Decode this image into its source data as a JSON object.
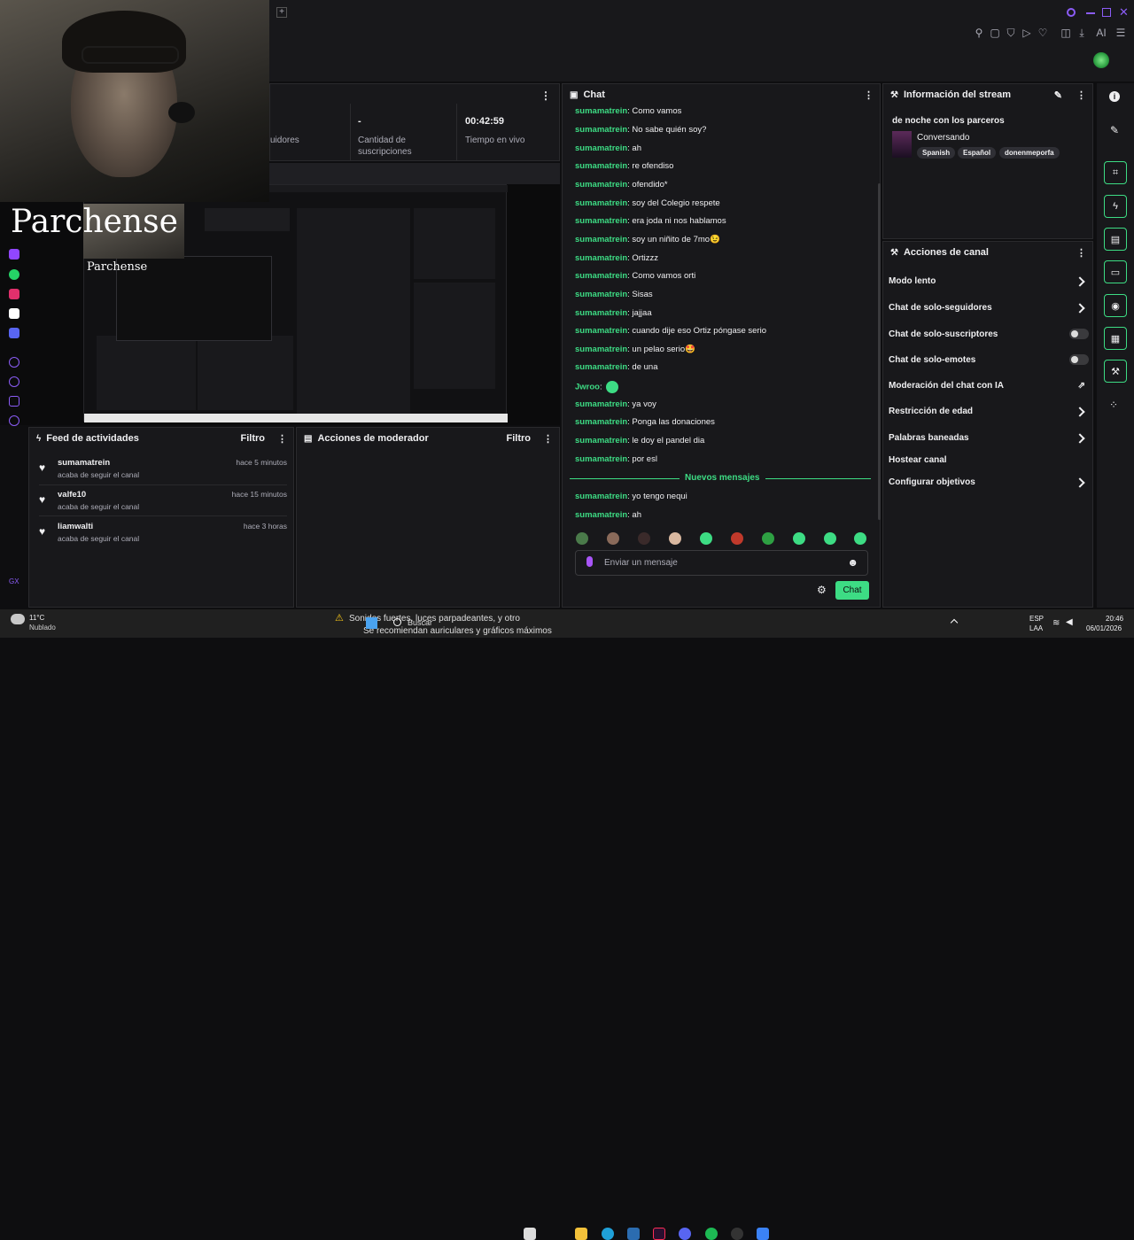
{
  "stats": {
    "followers_label": "uidores",
    "subs_value": "-",
    "subs_label": "Cantidad de suscripciones",
    "time_value": "00:42:59",
    "time_label": "Tiempo en vivo"
  },
  "overlay": {
    "title": "Parchense"
  },
  "chat": {
    "header": "Chat",
    "messages": [
      {
        "user": "sumamatrein",
        "text": "Como vamos"
      },
      {
        "user": "sumamatrein",
        "text": "No sabe quién soy?"
      },
      {
        "user": "sumamatrein",
        "text": "ah"
      },
      {
        "user": "sumamatrein",
        "text": "re ofendiso"
      },
      {
        "user": "sumamatrein",
        "text": "ofendido*"
      },
      {
        "user": "sumamatrein",
        "text": "soy del Colegio respete"
      },
      {
        "user": "sumamatrein",
        "text": "era joda ni nos hablamos"
      },
      {
        "user": "sumamatrein",
        "text": "soy un niñito de 7mo😉"
      },
      {
        "user": "sumamatrein",
        "text": "Ortizzz"
      },
      {
        "user": "sumamatrein",
        "text": "Como vamos orti"
      },
      {
        "user": "sumamatrein",
        "text": "Sisas"
      },
      {
        "user": "sumamatrein",
        "text": "jajjaa"
      },
      {
        "user": "sumamatrein",
        "text": "cuando dije eso Ortiz póngase serio"
      },
      {
        "user": "sumamatrein",
        "text": "un pelao serio🤩"
      },
      {
        "user": "sumamatrein",
        "text": "de una"
      },
      {
        "user": "Jwroo",
        "text": ""
      },
      {
        "user": "sumamatrein",
        "text": "ya voy"
      },
      {
        "user": "sumamatrein",
        "text": "Ponga las donaciones"
      },
      {
        "user": "sumamatrein",
        "text": "le doy el pandel dia"
      },
      {
        "user": "sumamatrein",
        "text": "por esl"
      }
    ],
    "new_messages_label": "Nuevos mensajes",
    "new_messages": [
      {
        "user": "sumamatrein",
        "text": "yo tengo nequi"
      },
      {
        "user": "sumamatrein",
        "text": "ah"
      }
    ],
    "input_placeholder": "Enviar un mensaje",
    "send_label": "Chat"
  },
  "stream_info": {
    "header": "Información del stream",
    "title": "de noche con los parceros",
    "category": "Conversando",
    "tags": [
      "Spanish",
      "Español",
      "donenmeporfa"
    ]
  },
  "channel_actions": {
    "header": "Acciones de canal",
    "items": [
      {
        "label": "Modo lento",
        "control": "chevron"
      },
      {
        "label": "Chat de solo-seguidores",
        "control": "chevron"
      },
      {
        "label": "Chat de solo-suscriptores",
        "control": "toggle"
      },
      {
        "label": "Chat de solo-emotes",
        "control": "toggle"
      },
      {
        "label": "Moderación del chat con IA",
        "control": "external"
      },
      {
        "label": "Restricción de edad",
        "control": "chevron"
      },
      {
        "label": "Palabras baneadas",
        "control": "chevron"
      },
      {
        "label": "Hostear canal",
        "control": "none"
      },
      {
        "label": "Configurar objetivos",
        "control": "chevron"
      }
    ]
  },
  "activity_feed": {
    "header": "Feed de actividades",
    "filter": "Filtro",
    "items": [
      {
        "user": "sumamatrein",
        "action": "acaba de seguir el canal",
        "time": "hace 5 minutos"
      },
      {
        "user": "valfe10",
        "action": "acaba de seguir el canal",
        "time": "hace 15 minutos"
      },
      {
        "user": "liamwalti",
        "action": "acaba de seguir el canal",
        "time": "hace 3 horas"
      }
    ]
  },
  "mod_actions": {
    "header": "Acciones de moderador",
    "filter": "Filtro"
  },
  "taskbar": {
    "weather_temp": "11°C",
    "weather_desc": "Nublado",
    "notice1": "Sonidos fuertes, luces parpadeantes, y otro",
    "notice2": "Se recomiendan auriculares y gráficos máximos",
    "search": "Buscar",
    "lang": "ESP",
    "lang2": "LAA",
    "time": "20:46",
    "date": "06/01/2026"
  },
  "left_label": "GX",
  "colors": {
    "accent": "#3ddc84",
    "bg": "#0e0e10",
    "panel": "#18181b"
  }
}
